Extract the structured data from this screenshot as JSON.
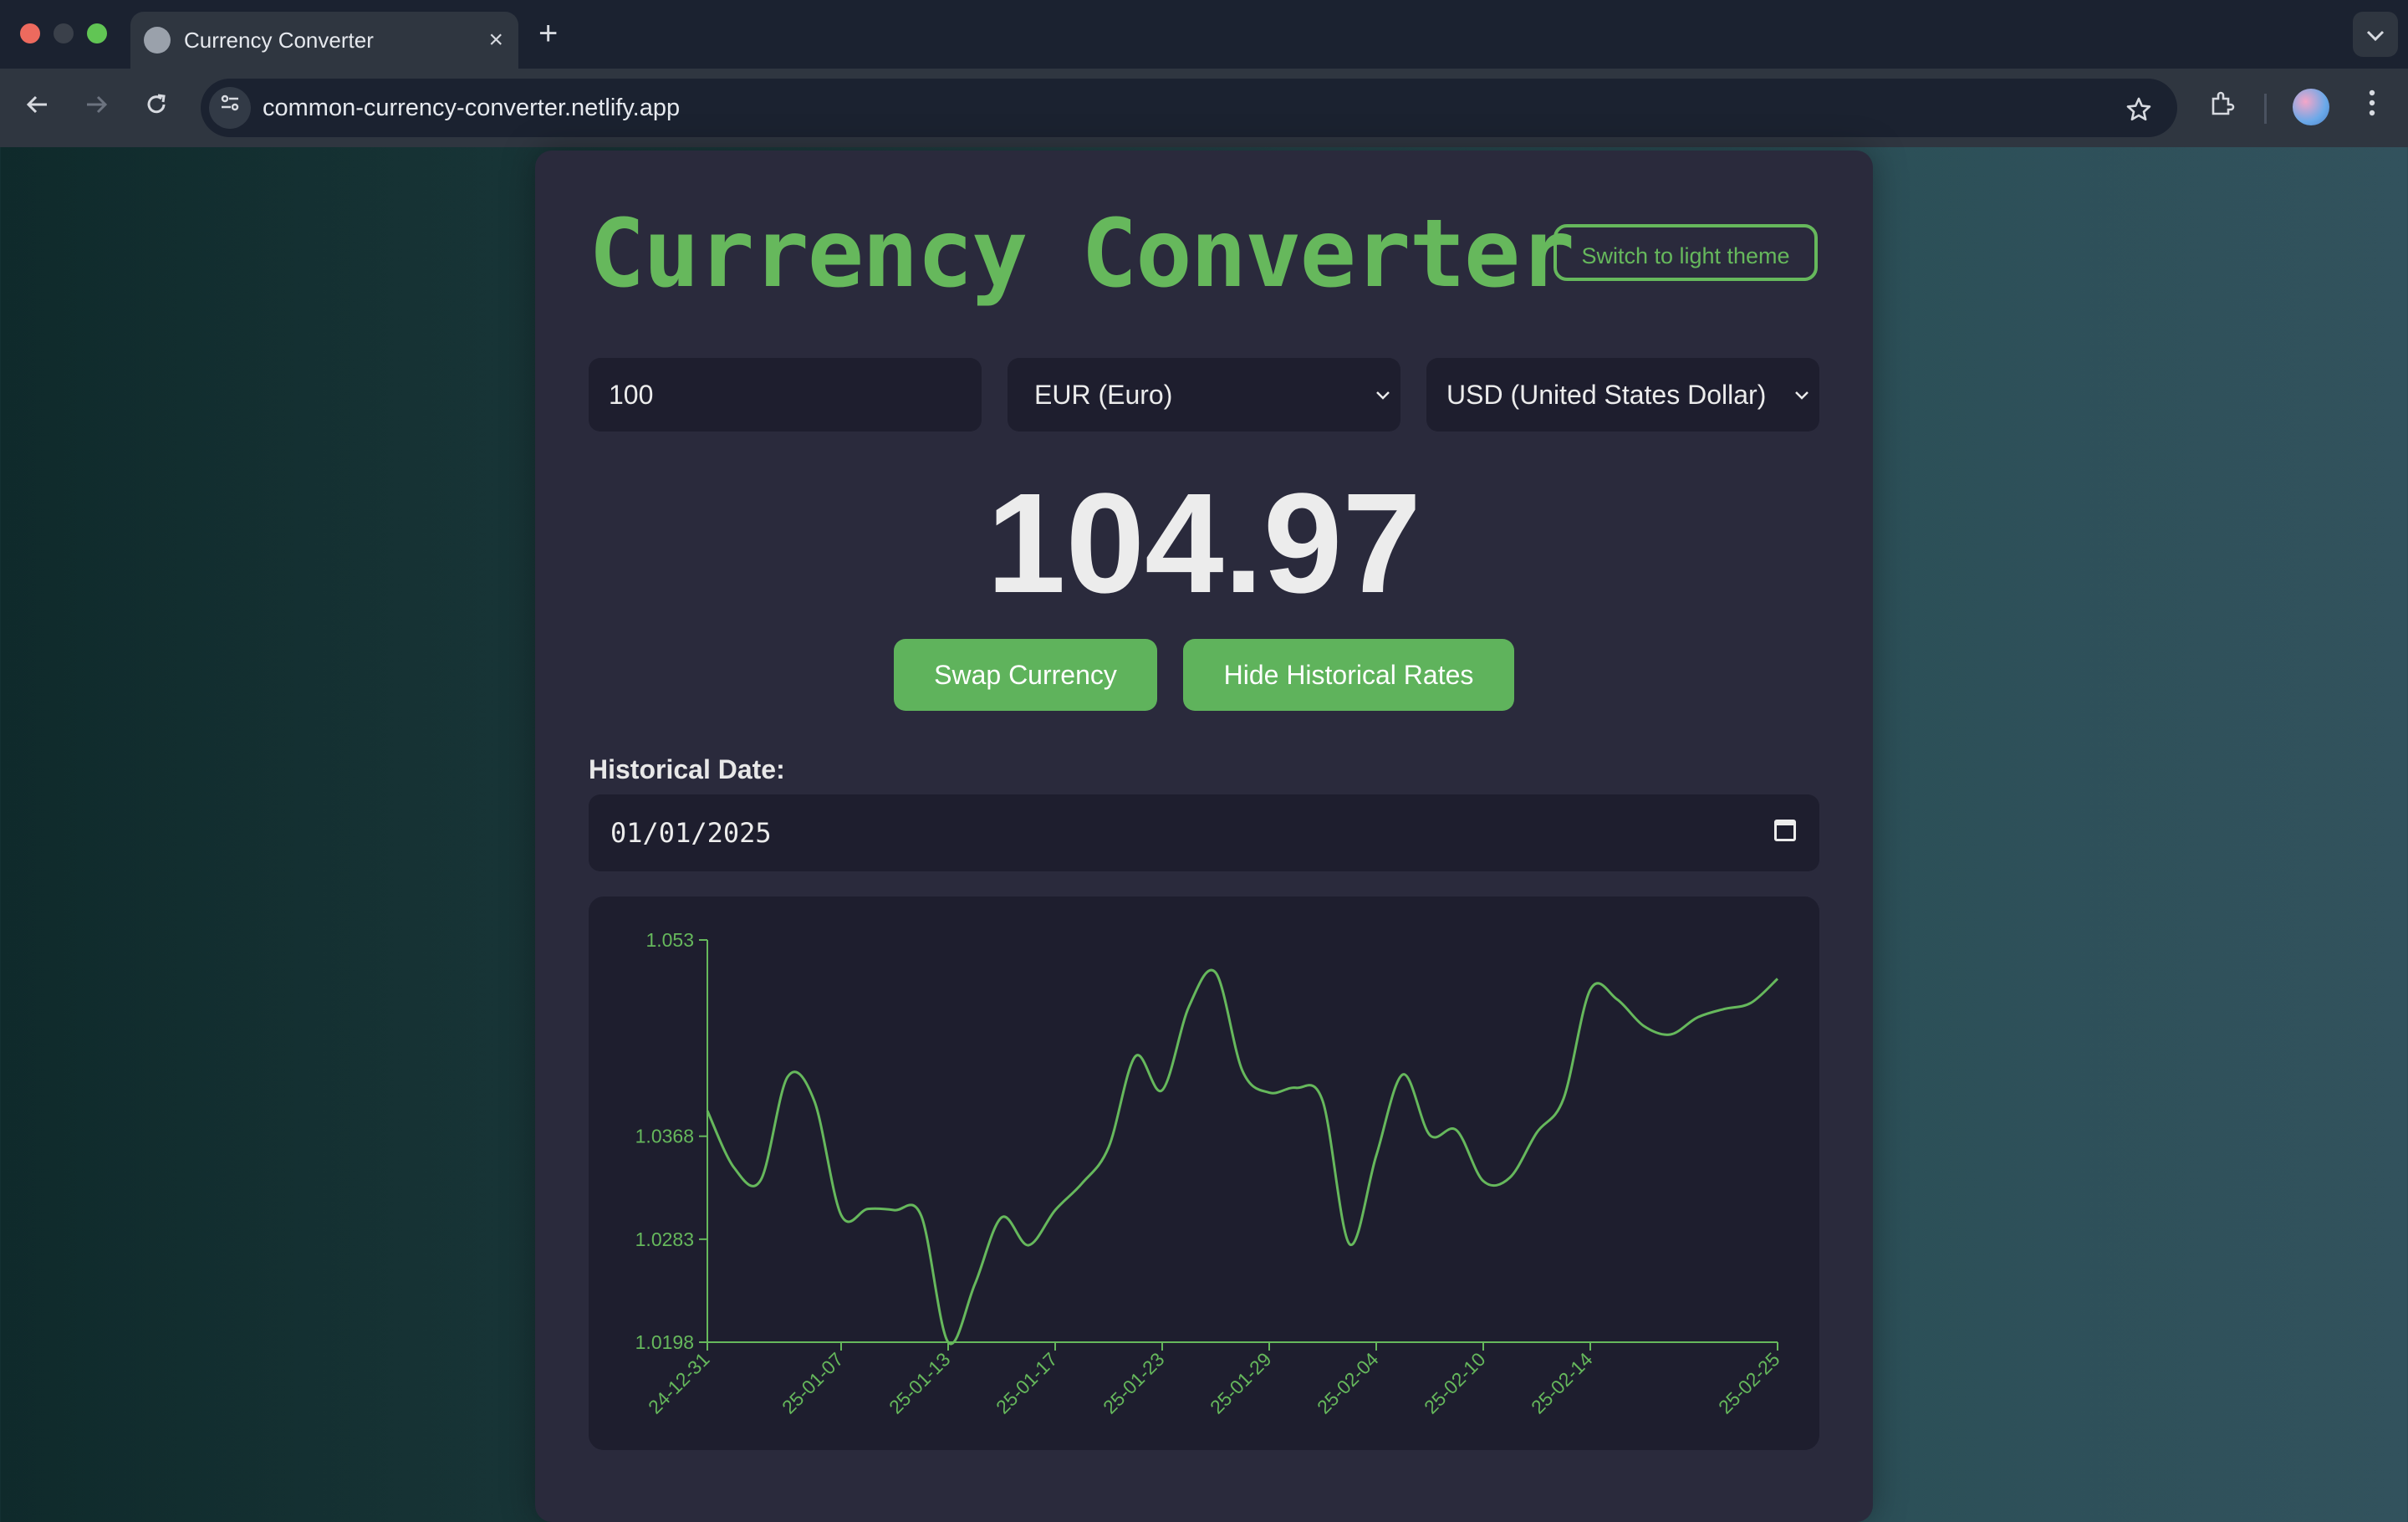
{
  "browser": {
    "tab_title": "Currency Converter",
    "tab_close": "×",
    "new_tab": "+",
    "url": "common-currency-converter.netlify.app"
  },
  "app": {
    "title": "Currency Converter",
    "theme_button": "Switch to light theme",
    "amount": "100",
    "from_currency": "EUR (Euro)",
    "to_currency": "USD (United States Dollar)",
    "result": "104.97",
    "swap_button": "Swap Currency",
    "hide_button": "Hide Historical Rates",
    "historical_label": "Historical Date:",
    "historical_date": "01/01/2025"
  },
  "colors": {
    "accent": "#66b85c",
    "card": "#2a2a3c",
    "field": "#1e1e2e"
  },
  "chart_data": {
    "type": "line",
    "ylim": [
      1.0198,
      1.053
    ],
    "y_ticks": [
      "1.053",
      "1.0368",
      "1.0283",
      "1.0198"
    ],
    "x_ticks": [
      "24-12-31",
      "25-01-07",
      "25-01-13",
      "25-01-17",
      "25-01-23",
      "25-01-29",
      "25-02-04",
      "25-02-10",
      "25-02-14",
      "25-02-25"
    ],
    "series": [
      {
        "x": [
          "24-12-31",
          "25-01-01",
          "25-01-02",
          "25-01-03",
          "25-01-06",
          "25-01-07",
          "25-01-08",
          "25-01-09",
          "25-01-10",
          "25-01-13",
          "25-01-14",
          "25-01-15",
          "25-01-16",
          "25-01-17",
          "25-01-20",
          "25-01-21",
          "25-01-22",
          "25-01-23",
          "25-01-24",
          "25-01-27",
          "25-01-28",
          "25-01-29",
          "25-01-30",
          "25-01-31",
          "25-02-03",
          "25-02-04",
          "25-02-05",
          "25-02-06",
          "25-02-07",
          "25-02-10",
          "25-02-11",
          "25-02-12",
          "25-02-13",
          "25-02-14",
          "25-02-17",
          "25-02-18",
          "25-02-19",
          "25-02-20",
          "25-02-21",
          "25-02-24",
          "25-02-25"
        ],
        "values": [
          1.0389,
          1.0342,
          1.0332,
          1.0417,
          1.0397,
          1.0303,
          1.0308,
          1.0307,
          1.0302,
          1.0198,
          1.0246,
          1.0301,
          1.0278,
          1.0307,
          1.0329,
          1.0359,
          1.0434,
          1.0406,
          1.0475,
          1.0503,
          1.0422,
          1.0404,
          1.0408,
          1.0397,
          1.0279,
          1.0352,
          1.0419,
          1.0369,
          1.0373,
          1.0331,
          1.0334,
          1.0371,
          1.0399,
          1.0489,
          1.0481,
          1.0459,
          1.0452,
          1.0466,
          1.0473,
          1.0478,
          1.0498
        ]
      }
    ]
  }
}
